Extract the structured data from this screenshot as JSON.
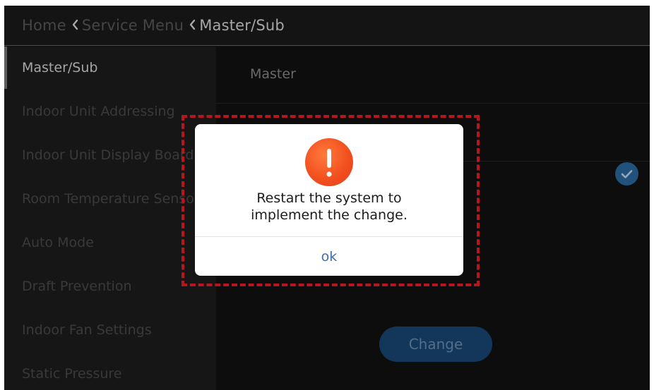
{
  "breadcrumb": {
    "home": "Home",
    "service_menu": "Service Menu",
    "current": "Master/Sub"
  },
  "sidebar": {
    "items": [
      {
        "label": "Master/Sub"
      },
      {
        "label": "Indoor Unit Addressing"
      },
      {
        "label": "Indoor Unit Display Board"
      },
      {
        "label": "Room Temperature Sensor"
      },
      {
        "label": "Auto Mode"
      },
      {
        "label": "Draft Prevention"
      },
      {
        "label": "Indoor Fan Settings"
      },
      {
        "label": "Static Pressure"
      }
    ]
  },
  "main": {
    "option_master": "Master",
    "change_label": "Change"
  },
  "dialog": {
    "icon": "alert-exclamation-icon",
    "message_line1": "Restart the system to",
    "message_line2": "implement the change.",
    "ok_label": "ok"
  },
  "colors": {
    "accent": "#2b6ea7",
    "alert": "#f2501f",
    "highlight_border": "#b8161f"
  }
}
